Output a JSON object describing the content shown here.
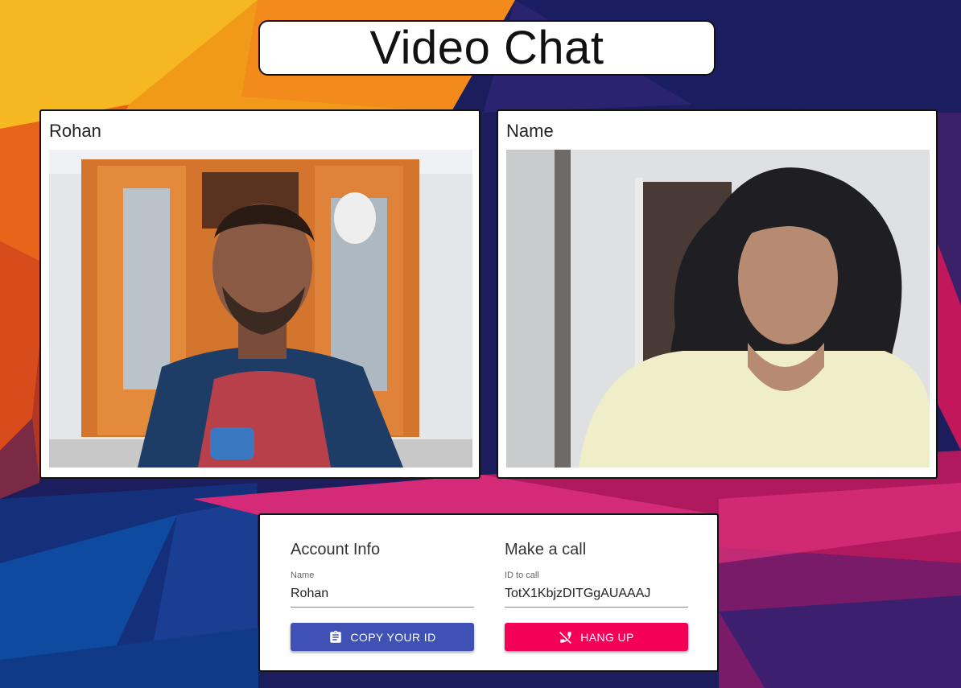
{
  "app": {
    "title": "Video Chat"
  },
  "videos": {
    "local": {
      "name": "Rohan"
    },
    "remote": {
      "name": "Name"
    }
  },
  "account": {
    "heading": "Account Info",
    "name_label": "Name",
    "name_value": "Rohan",
    "copy_button": "COPY YOUR ID",
    "copy_icon": "clipboard-icon"
  },
  "call": {
    "heading": "Make a call",
    "id_label": "ID to call",
    "id_value": "TotX1KbjzDITGgAUAAAJ",
    "hangup_button": "HANG UP",
    "hangup_icon": "phone-disabled-icon"
  },
  "colors": {
    "primary_button": "#3f51b5",
    "secondary_button": "#f50057"
  }
}
